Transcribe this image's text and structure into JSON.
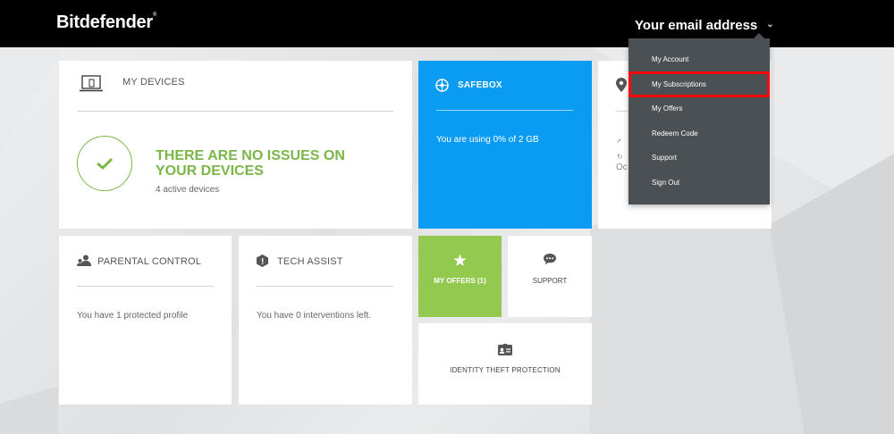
{
  "header": {
    "logo": "Bitdefender",
    "logo_mark": "®",
    "account_label": "Your email address"
  },
  "account_menu": {
    "items": [
      {
        "label": "My Account"
      },
      {
        "label": "My Subscriptions"
      },
      {
        "label": "My Offers"
      },
      {
        "label": "Redeem Code"
      },
      {
        "label": "Support"
      },
      {
        "label": "Sign Out"
      }
    ],
    "highlighted": "My Subscriptions"
  },
  "devices": {
    "title": "MY DEVICES",
    "headline": "THERE ARE NO ISSUES ON YOUR DEVICES",
    "subtext": "4 active devices"
  },
  "safebox": {
    "title": "SAFEBOX",
    "text": "You are using 0% of 2 GB"
  },
  "anti_theft": {
    "partial_text": "Oc"
  },
  "parental": {
    "title": "PARENTAL CONTROL",
    "text": "You have 1 protected profile"
  },
  "tech_assist": {
    "title": "TECH ASSIST",
    "text": "You have 0 interventions left."
  },
  "offers": {
    "label": "MY OFFERS (1)"
  },
  "support": {
    "label": "SUPPORT"
  },
  "itp": {
    "label": "IDENTITY THEFT PROTECTION"
  },
  "colors": {
    "accent_green": "#7ab648",
    "safebox_blue": "#0a9bf2",
    "offers_green": "#93c94f",
    "menu_bg": "#4a5054",
    "highlight_red": "#ff0a0a"
  },
  "icons": [
    "laptop-phone-icon",
    "checkmark-icon",
    "safebox-icon",
    "location-pin-icon",
    "parental-icon",
    "shield-icon",
    "star-icon",
    "chat-icon",
    "id-card-icon",
    "chevron-down-icon"
  ]
}
